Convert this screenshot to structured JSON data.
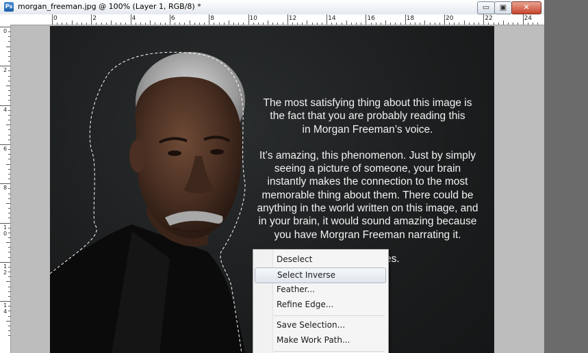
{
  "window": {
    "title": "morgan_freeman.jpg @ 100% (Layer 1, RGB/8) *",
    "app_icon": "Ps",
    "controls": {
      "minimize": "▭",
      "maximize": "▣",
      "close": "✕"
    }
  },
  "ruler": {
    "horizontal_labels": [
      "0",
      "2",
      "4",
      "6",
      "8",
      "10",
      "12",
      "14",
      "16",
      "18",
      "20",
      "22",
      "24"
    ],
    "vertical_labels": [
      "0",
      "2",
      "4",
      "6",
      "8",
      "10",
      "12",
      "14"
    ]
  },
  "image": {
    "text_paragraphs": [
      "The most satisfying thing about this image is\nthe fact that you are probably reading this\nin Morgan Freeman’s voice.",
      "It’s amazing, this phenomenon. Just by simply\nseeing a picture of someone, your brain\ninstantly makes the connection to the most\nmemorable thing about them. There could be\nanything in the world written on this image, and\nin your brain, it would sound amazing because\nyou have Morgran Freeman narrating it."
    ],
    "partial_text": "es."
  },
  "context_menu": {
    "items": [
      {
        "label": "Deselect"
      },
      {
        "label": "Select Inverse"
      },
      {
        "label": "Feather..."
      },
      {
        "label": "Refine Edge..."
      },
      {
        "label": "Save Selection..."
      },
      {
        "label": "Make Work Path..."
      }
    ]
  }
}
